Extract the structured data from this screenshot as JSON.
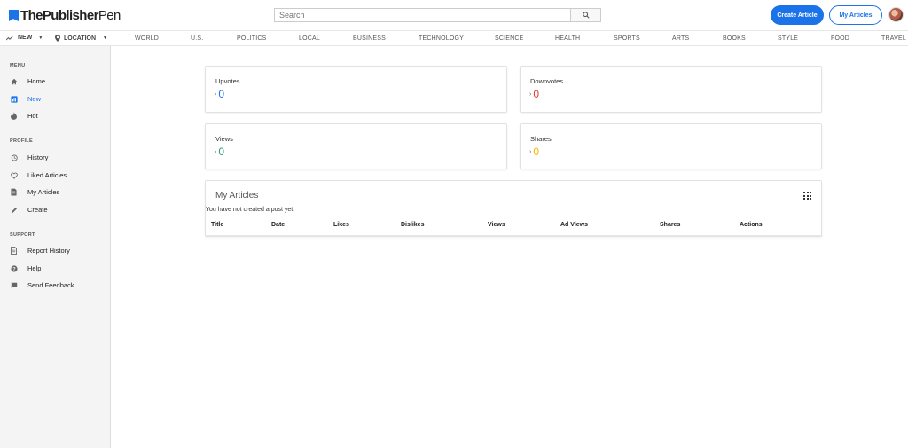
{
  "header": {
    "logo_text_bold": "ThePublisher",
    "logo_text_rest": "Pen",
    "search_placeholder": "Search",
    "create_button": "Create Article",
    "my_articles_button": "My Articles"
  },
  "navbar": {
    "new_label": "NEW",
    "location_label": "LOCATION",
    "categories": [
      "WORLD",
      "U.S.",
      "POLITICS",
      "LOCAL",
      "BUSINESS",
      "TECHNOLOGY",
      "SCIENCE",
      "HEALTH",
      "SPORTS",
      "ARTS",
      "BOOKS",
      "STYLE",
      "FOOD",
      "TRAVEL"
    ]
  },
  "sidebar": {
    "menu_title": "MENU",
    "menu_items": [
      {
        "label": "Home",
        "icon": "home-icon"
      },
      {
        "label": "New",
        "icon": "new-icon",
        "active": true
      },
      {
        "label": "Hot",
        "icon": "fire-icon"
      }
    ],
    "profile_title": "PROFILE",
    "profile_items": [
      {
        "label": "History",
        "icon": "history-icon"
      },
      {
        "label": "Liked Articles",
        "icon": "heart-icon"
      },
      {
        "label": "My Articles",
        "icon": "document-icon"
      },
      {
        "label": "Create",
        "icon": "pencil-icon"
      }
    ],
    "support_title": "SUPPORT",
    "support_items": [
      {
        "label": "Report History",
        "icon": "report-icon"
      },
      {
        "label": "Help",
        "icon": "help-icon"
      },
      {
        "label": "Send Feedback",
        "icon": "feedback-icon"
      }
    ]
  },
  "stats": {
    "upvotes": {
      "label": "Upvotes",
      "value": "0",
      "color": "#1a73e8"
    },
    "downvotes": {
      "label": "Downvotes",
      "value": "0",
      "color": "#e53935"
    },
    "views": {
      "label": "Views",
      "value": "0",
      "color": "#2e9c6a"
    },
    "shares": {
      "label": "Shares",
      "value": "0",
      "color": "#f4b400"
    }
  },
  "articles": {
    "title": "My Articles",
    "empty_message": "You have not created a post yet.",
    "columns": [
      "Title",
      "Date",
      "Likes",
      "Dislikes",
      "Views",
      "Ad Views",
      "Shares",
      "Actions"
    ]
  },
  "colors": {
    "accent": "#1a73e8"
  }
}
